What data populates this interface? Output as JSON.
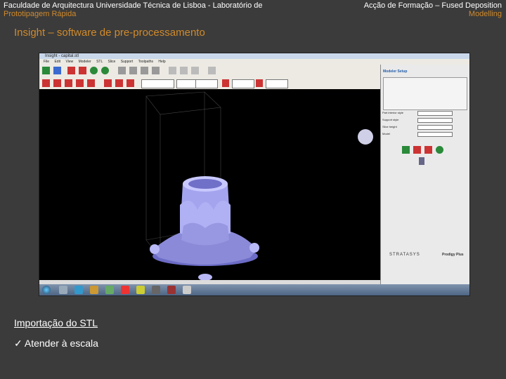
{
  "header": {
    "left_line1": "Faculdade de Arquitectura Universidade Técnica de Lisboa - Laboratório de",
    "left_line2": "Prototipagem Rápida",
    "right_line1": "Acção de Formação – Fused Deposition",
    "right_line2": "Modelling"
  },
  "slide_title": "Insight – software de pre-processamento",
  "screenshot": {
    "window_title": "Insight - capital.stl",
    "menu": [
      "File",
      "Edit",
      "View",
      "Modeler",
      "STL",
      "Slice",
      "Support",
      "Toolpaths",
      "Help"
    ],
    "panel": {
      "title": "Modeler Setup",
      "fields": [
        "Part interior style",
        "Support style",
        "Slice height",
        "Model",
        "Support"
      ]
    },
    "brand": "STRATASYS",
    "product": "Prodigy Plus"
  },
  "caption": "Importação do STL",
  "bullet": {
    "mark": "✓",
    "text": "Atender à escala"
  },
  "colors": {
    "background": "#3b3b3b",
    "accent": "#d08a2c",
    "model": "#a9a9f0"
  }
}
